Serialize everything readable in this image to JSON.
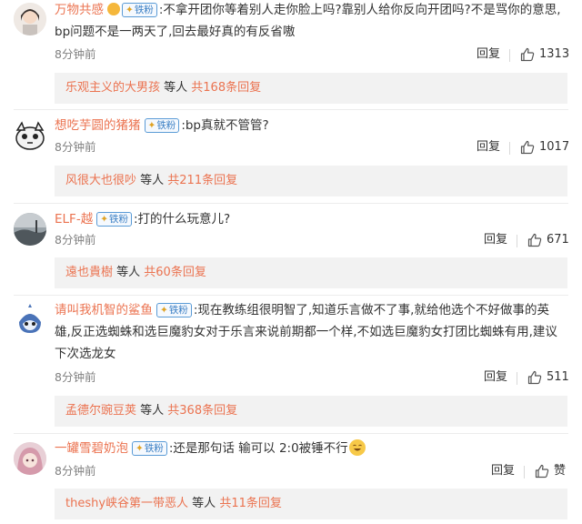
{
  "comments": [
    {
      "username": "万物共感",
      "badge": "铁粉",
      "text_lines": [
        ":不拿开团你等着别人走你脸上吗?靠别人给你反向开团吗?不是骂你的意思,",
        "bp问题不是一两天了,回去最好真的有反省嗷"
      ],
      "time": "8分钟前",
      "reply_label": "回复",
      "likes": "1313",
      "sub": {
        "name": "乐观主义的大男孩",
        "mid": " 等人 ",
        "count": "共168条回复"
      }
    },
    {
      "username": "想吃芋圆的猪猪",
      "badge": "铁粉",
      "text_lines": [
        ":bp真就不管管?"
      ],
      "time": "8分钟前",
      "reply_label": "回复",
      "likes": "1017",
      "sub": {
        "name": "风很大也很吵",
        "mid": " 等人 ",
        "count": "共211条回复"
      }
    },
    {
      "username": "ELF-越",
      "badge": "铁粉",
      "text_lines": [
        ":打的什么玩意儿?"
      ],
      "time": "8分钟前",
      "reply_label": "回复",
      "likes": "671",
      "sub": {
        "name": "遠也貴樹",
        "mid": " 等人 ",
        "count": "共60条回复"
      }
    },
    {
      "username": "请叫我机智的鲨鱼",
      "badge": "铁粉",
      "text_lines": [
        ":现在教练组很明智了,知道乐言做不了事,就给他选个不好做事的英",
        "雄,反正选蜘蛛和选巨魔豹女对于乐言来说前期都一个样,不如选巨魔豹女打团比蜘蛛有用,建议",
        "下次选龙女"
      ],
      "time": "8分钟前",
      "reply_label": "回复",
      "likes": "511",
      "sub": {
        "name": "孟德尔豌豆荚",
        "mid": " 等人 ",
        "count": "共368条回复"
      }
    },
    {
      "username": "一罐雪碧奶泡",
      "badge": "铁粉",
      "text_lines": [
        ":还是那句话 输可以 2:0被锤不行"
      ],
      "time": "8分钟前",
      "reply_label": "回复",
      "likes": "赞",
      "sub": {
        "name": "theshy峡谷第一带恶人",
        "mid": " 等人 ",
        "count": "共11条回复"
      }
    }
  ],
  "colors": {
    "username": "#eb7350",
    "badge": "#3b7fc4",
    "meta": "#808080",
    "subreply_bg": "#f2f2f2"
  },
  "icons": [
    "thumb-up-icon",
    "avatar",
    "laughing-emoji-icon"
  ]
}
